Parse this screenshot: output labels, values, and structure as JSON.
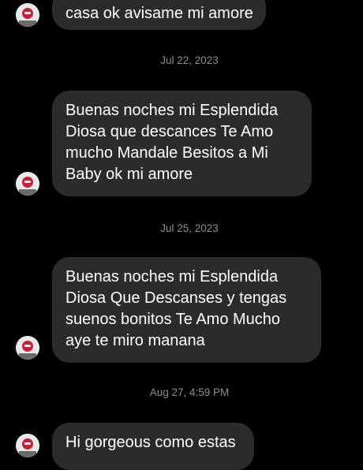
{
  "colors": {
    "background": "#000000",
    "bubble": "#2b2b2b",
    "message_text": "#ffffff",
    "date_text": "#8e8e8e",
    "avatar_bg": "#e9e9e9",
    "avatar_accent": "#c4203a"
  },
  "avatar_icon": "profile-picture-icon",
  "messages": [
    {
      "lines": [
        "casa ok avisame mi amore"
      ]
    },
    {
      "lines": [
        "Buenas noches mi Esplendida",
        "Diosa que descances Te Amo",
        "mucho Mandale Besitos a Mi",
        "Baby ok mi amore"
      ]
    },
    {
      "lines": [
        "Buenas noches mi Esplendida",
        "Diosa Que Descanses y tengas",
        "suenos bonitos Te Amo Mucho",
        "aye te miro manana"
      ]
    },
    {
      "lines": [
        "Hi gorgeous como estas"
      ]
    }
  ],
  "dates": [
    "Jul 22, 2023",
    "Jul 25, 2023",
    "Aug 27, 4:59 PM"
  ]
}
